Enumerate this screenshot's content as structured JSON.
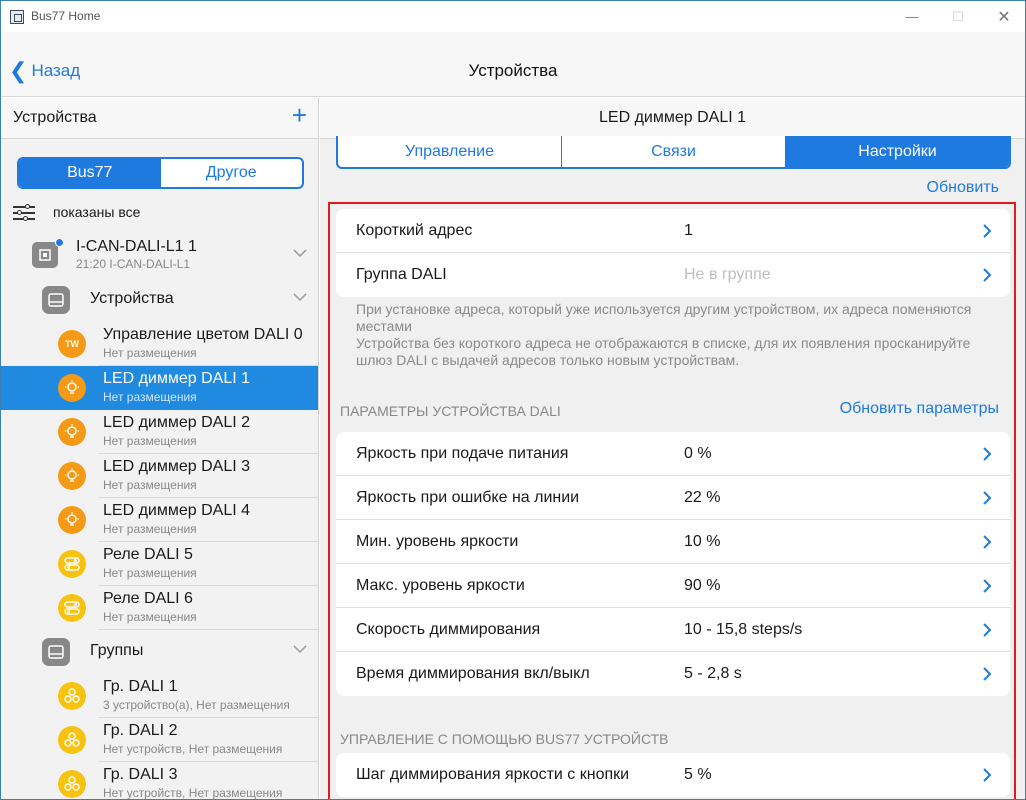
{
  "window": {
    "title": "Bus77 Home"
  },
  "nav": {
    "back": "Назад",
    "title": "Устройства"
  },
  "sidebar": {
    "header": "Устройства",
    "segments": [
      "Bus77",
      "Другое"
    ],
    "filter": "показаны все",
    "gateway": {
      "name": "I-CAN-DALI-L1 1",
      "sub": "21:20 I-CAN-DALI-L1"
    },
    "devices_group": "Устройства",
    "devices": [
      {
        "name": "Управление цветом DALI 0",
        "sub": "Нет размещения",
        "icon": "TW"
      },
      {
        "name": "LED диммер DALI 1",
        "sub": "Нет размещения"
      },
      {
        "name": "LED диммер DALI 2",
        "sub": "Нет размещения"
      },
      {
        "name": "LED диммер DALI 3",
        "sub": "Нет размещения"
      },
      {
        "name": "LED диммер DALI 4",
        "sub": "Нет размещения"
      },
      {
        "name": "Реле DALI 5",
        "sub": "Нет размещения"
      },
      {
        "name": "Реле DALI 6",
        "sub": "Нет размещения"
      }
    ],
    "groups_group": "Группы",
    "groups": [
      {
        "name": "Гр. DALI 1",
        "sub": "3 устройство(а), Нет размещения"
      },
      {
        "name": "Гр. DALI 2",
        "sub": "Нет устройств, Нет размещения"
      },
      {
        "name": "Гр. DALI 3",
        "sub": "Нет устройств, Нет размещения"
      }
    ]
  },
  "main": {
    "title": "LED диммер DALI 1",
    "tabs": [
      "Управление",
      "Связи",
      "Настройки"
    ],
    "refresh": "Обновить",
    "addr_rows": [
      {
        "label": "Короткий адрес",
        "value": "1"
      },
      {
        "label": "Группа DALI",
        "value": "Не в группе"
      }
    ],
    "note": "При установке адреса, который уже используется другим устройством, их адреса поменяются местами\nУстройства без короткого адреса не отображаются в списке, для их появления просканируйте шлюз DALI с выдачей адресов только новым устройствам.",
    "params_header": "ПАРАМЕТРЫ УСТРОЙСТВА DALI",
    "params_refresh": "Обновить параметры",
    "params": [
      {
        "label": "Яркость при подаче питания",
        "value": "0 %"
      },
      {
        "label": "Яркость при ошибке на линии",
        "value": "22 %"
      },
      {
        "label": "Мин. уровень яркости",
        "value": "10 %"
      },
      {
        "label": "Макс. уровень яркости",
        "value": "90 %"
      },
      {
        "label": "Скорость диммирования",
        "value": "10 - 15,8 steps/s"
      },
      {
        "label": "Время диммирования вкл/выкл",
        "value": "5 - 2,8 s"
      }
    ],
    "bus_header": "УПРАВЛЕНИЕ С ПОМОЩЬЮ BUS77 УСТРОЙСТВ",
    "bus_rows": [
      {
        "label": "Шаг диммирования яркости с кнопки",
        "value": "5 %"
      }
    ]
  }
}
